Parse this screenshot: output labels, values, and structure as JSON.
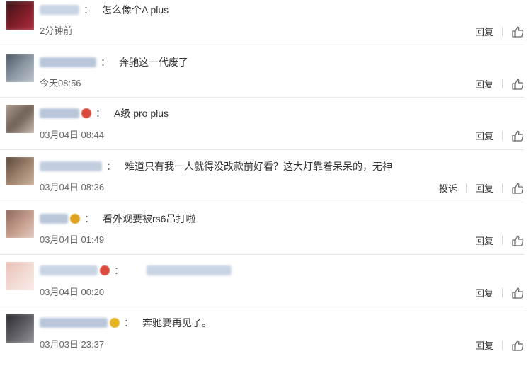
{
  "comments": [
    {
      "text": "怎么像个A plus",
      "time": "2分钟前",
      "avatar_colors": [
        "#2a1416",
        "#7a1b26",
        "#b5313f"
      ],
      "name_color": "#c8d4e4",
      "name_width": 56,
      "actions": [
        "回复"
      ]
    },
    {
      "text": "奔驰这一代废了",
      "time": "今天08:56",
      "avatar_colors": [
        "#3c4752",
        "#8a96a2",
        "#c4ccd4"
      ],
      "name_color": "#b8c6da",
      "name_width": 80,
      "actions": [
        "回复"
      ]
    },
    {
      "text": "A级 pro plus",
      "time": "03月04日 08:44",
      "avatar_colors": [
        "#b9a89a",
        "#6f6055",
        "#d8cbc0"
      ],
      "name_color": "#b8c6da",
      "name_width": 56,
      "badge_color": "#d94a3d",
      "actions": [
        "回复"
      ]
    },
    {
      "text": "难道只有我一人就得没改款前好看？这大灯靠着呆呆的，无神",
      "time": "03月04日 08:36",
      "avatar_colors": [
        "#4a3a2e",
        "#9b7f69",
        "#d3bba6"
      ],
      "name_color": "#c2cedf",
      "name_width": 88,
      "actions": [
        "投诉",
        "回复"
      ]
    },
    {
      "text": "看外观要被rs6吊打啦",
      "time": "03月04日 01:49",
      "avatar_colors": [
        "#7d5a4f",
        "#c29a89",
        "#e8d2c6"
      ],
      "name_color": "#b8c6da",
      "name_width": 40,
      "badge_color": "#e0a11c",
      "actions": [
        "回复"
      ]
    },
    {
      "text": "",
      "time": "03月04日 00:20",
      "avatar_colors": [
        "#e4b9ad",
        "#f2d9d2",
        "#fbeee9"
      ],
      "name_color": "#c8d4e4",
      "name_width": 82,
      "badge_color": "#d94a3d",
      "extra_name": true,
      "actions": [
        "回复"
      ]
    },
    {
      "text": "奔驰要再见了。",
      "time": "03月03日 23:37",
      "avatar_colors": [
        "#1f1f22",
        "#5c5c62",
        "#9a9aa0"
      ],
      "name_color": "#b8c6da",
      "name_width": 96,
      "badge_color": "#e6b422",
      "actions": [
        "回复"
      ]
    }
  ],
  "colon": "："
}
